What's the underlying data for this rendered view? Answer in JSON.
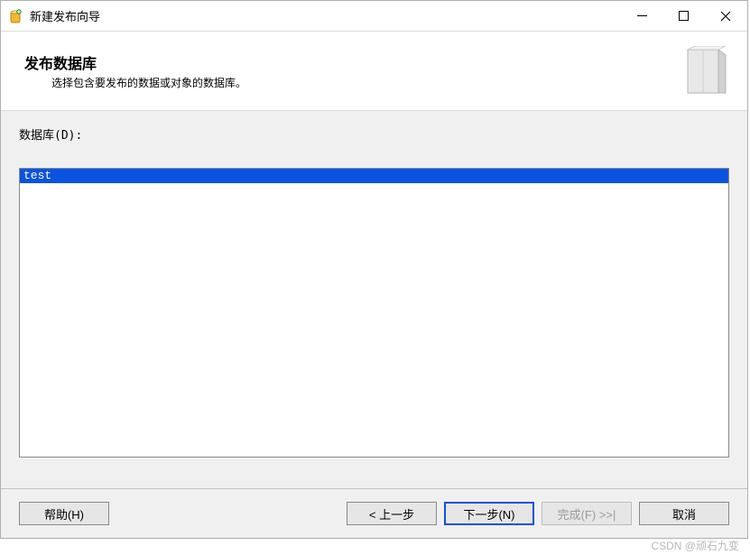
{
  "window": {
    "title": "新建发布向导"
  },
  "header": {
    "title": "发布数据库",
    "subtitle": "选择包含要发布的数据或对象的数据库。"
  },
  "content": {
    "list_label": "数据库(D):",
    "items": [
      {
        "label": "test",
        "selected": true
      }
    ]
  },
  "buttons": {
    "help": "帮助(H)",
    "back": "< 上一步",
    "next": "下一步(N)",
    "finish": "完成(F) >>|",
    "cancel": "取消"
  },
  "watermark": "CSDN @顽石九变"
}
